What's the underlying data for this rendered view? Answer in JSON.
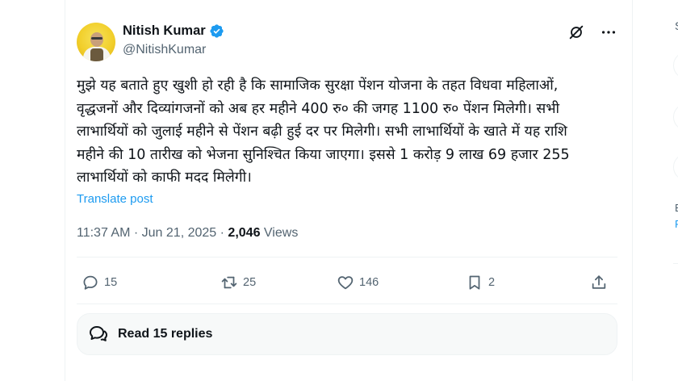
{
  "author": {
    "name": "Nitish Kumar",
    "handle": "@NitishKumar",
    "verified": true
  },
  "post": {
    "text": "मुझे यह बताते हुए खुशी हो रही है कि सामाजिक सुरक्षा पेंशन योजना के तहत विधवा महिलाओं, वृद्धजनों और दिव्यांगजनों को अब हर महीने 400 रु० की जगह 1100 रु० पेंशन मिलेगी। सभी लाभार्थियों को जुलाई महीने से पेंशन बढ़ी हुई दर पर मिलेगी। सभी लाभार्थियों के खाते में यह राशि महीने की 10 तारीख को भेजना सुनिश्चित किया जाएगा। इससे 1 करोड़ 9 लाख 69 हजार 255 लाभार्थियों को काफी मदद मिलेगी।",
    "translate_label": "Translate post",
    "time": "11:37 AM",
    "date": "Jun 21, 2025",
    "views_count": "2,046",
    "views_label": "Views"
  },
  "actions": {
    "replies": "15",
    "reposts": "25",
    "likes": "146",
    "bookmarks": "2"
  },
  "replies_button": {
    "label": "Read 15 replies"
  },
  "right_rail": {
    "s_fragment": "S",
    "b_fragment": "E",
    "p_fragment": "P"
  },
  "colors": {
    "accent": "#1d9bf0",
    "text": "#0f1419",
    "muted": "#536471"
  }
}
